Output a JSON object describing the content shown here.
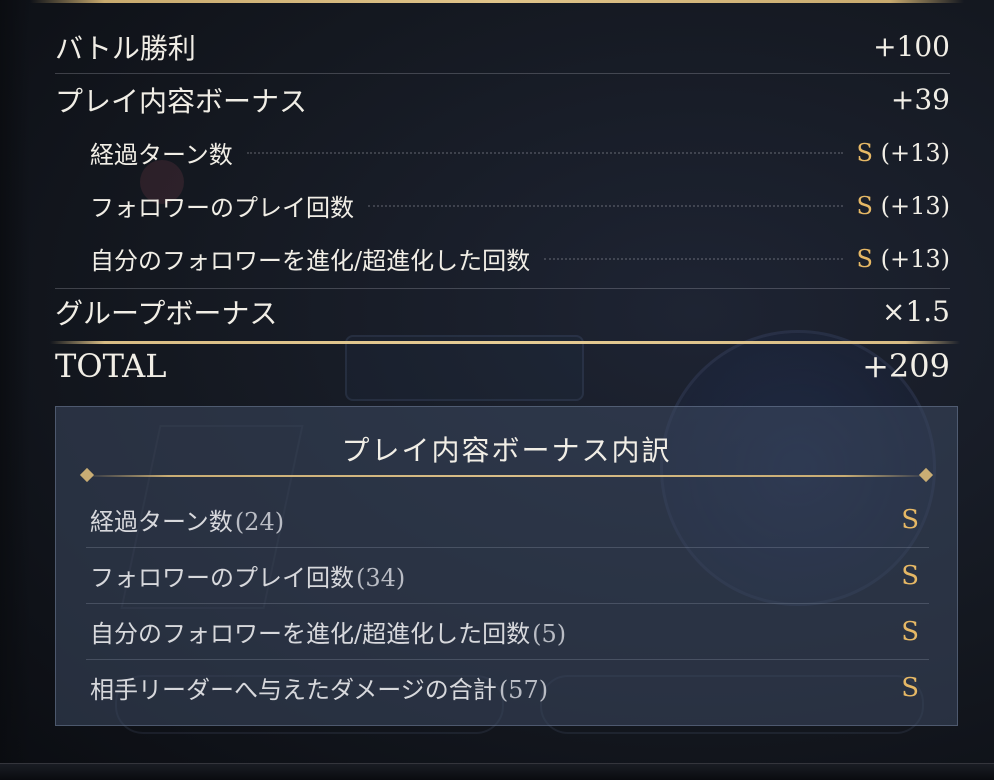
{
  "results": {
    "battle_win": {
      "label": "バトル勝利",
      "value": "+100"
    },
    "play_bonus": {
      "label": "プレイ内容ボーナス",
      "value": "+39"
    },
    "sub_items": [
      {
        "label": "経過ターン数",
        "grade": "S",
        "value": "(+13)"
      },
      {
        "label": "フォロワーのプレイ回数",
        "grade": "S",
        "value": "(+13)"
      },
      {
        "label": "自分のフォロワーを進化/超進化した回数",
        "grade": "S",
        "value": "(+13)"
      }
    ],
    "group_bonus": {
      "label": "グループボーナス",
      "value": "×1.5"
    },
    "total": {
      "label": "TOTAL",
      "value": "+209"
    }
  },
  "breakdown": {
    "title": "プレイ内容ボーナス内訳",
    "items": [
      {
        "label": "経過ターン数",
        "count": "(24)",
        "grade": "S"
      },
      {
        "label": "フォロワーのプレイ回数",
        "count": "(34)",
        "grade": "S"
      },
      {
        "label": "自分のフォロワーを進化/超進化した回数",
        "count": "(5)",
        "grade": "S"
      },
      {
        "label": "相手リーダーへ与えたダメージの合計",
        "count": "(57)",
        "grade": "S"
      }
    ]
  },
  "colors": {
    "gold": "#e6b865",
    "text": "#f1eee6",
    "panel": "#3c4860"
  }
}
